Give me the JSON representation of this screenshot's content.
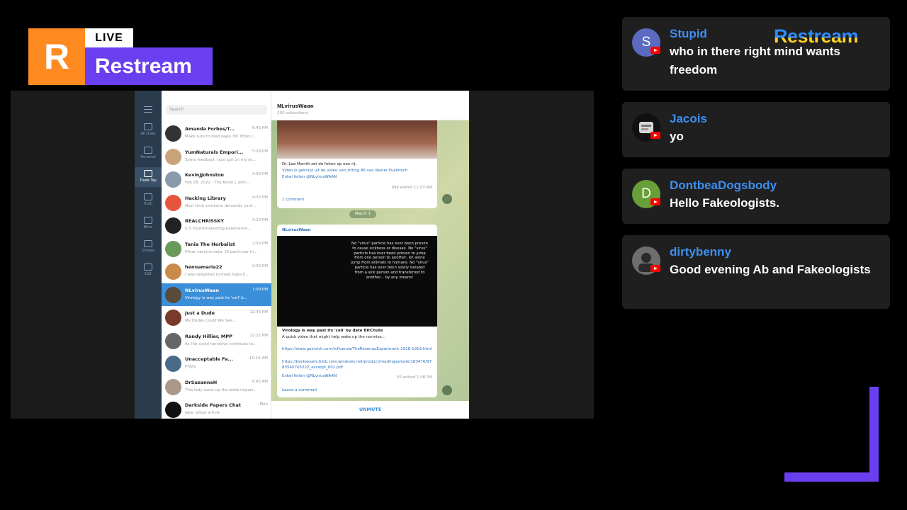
{
  "badge": {
    "logo_letter": "R",
    "live_label": "LIVE",
    "brand_name": "Restream"
  },
  "colors": {
    "brand_orange": "#ff8a1f",
    "brand_purple": "#6a3ff0",
    "author_blue": "#3d8ff0",
    "card_bg": "#1f1f1f"
  },
  "telegram": {
    "search_placeholder": "Search",
    "rail": [
      {
        "label": "All chats",
        "icon": "chat-bubble-icon"
      },
      {
        "label": "Personal",
        "icon": "folder-icon"
      },
      {
        "label": "Trade Top",
        "icon": "folder-icon"
      },
      {
        "label": "Truth",
        "icon": "folder-icon"
      },
      {
        "label": "Bitco",
        "icon": "folder-icon"
      },
      {
        "label": "Unread",
        "icon": "chat-bubble-icon"
      },
      {
        "label": "Edit",
        "icon": "sliders-icon"
      }
    ],
    "chats": [
      {
        "name": "Amanda Forbes/T...",
        "time": "6:45 PM",
        "preview": "Make sure to read page 30! https:/...",
        "color": "#333"
      },
      {
        "name": "YumNaturals Empori...",
        "time": "5:29 PM",
        "preview": "Some feedback i just got on my so...",
        "color": "#c9a47b"
      },
      {
        "name": "KevinJJohnston",
        "time": "3:00 PM",
        "preview": "Feb 28, 2022 - The Kevin J. John...",
        "color": "#8899aa"
      },
      {
        "name": "Hacking Library",
        "time": "4:55 PM",
        "preview": "Next time someone demands yout...",
        "color": "#e5553b"
      },
      {
        "name": "REALCHRISSKY",
        "time": "3:20 PM",
        "preview": "5.5.0-postmarketing-experience...",
        "color": "#222"
      },
      {
        "name": "Tania The Herbalist",
        "time": "2:50 PM",
        "preview": "Pfizer vaccine data. Of particular in...",
        "color": "#6a9a5a"
      },
      {
        "name": "hennamaria22",
        "time": "2:33 PM",
        "preview": "I was delighted to meet Kajia tl...",
        "color": "#c98a4a"
      },
      {
        "name": "NLvirusWaan",
        "time": "1:09 PM",
        "preview": "Virology is way past its 'cell' b...",
        "color": "#5a4a3a"
      },
      {
        "name": "Just a Dude",
        "time": "12:45 PM",
        "preview": "My Dudes Could We See...",
        "color": "#7a3a2a"
      },
      {
        "name": "Randy Hillier, MPP",
        "time": "12:21 PM",
        "preview": "As the covid narrative continues to...",
        "color": "#666"
      },
      {
        "name": "Unacceptable Fa...",
        "time": "10:19 AM",
        "preview": "Photo",
        "color": "#4a6a8a"
      },
      {
        "name": "DrSuzanneH",
        "time": "9:43 AM",
        "preview": "This lady sums up the woke import...",
        "color": "#aa9988"
      },
      {
        "name": "Darkside Papers Chat",
        "time": "Mon",
        "preview": "Jake: Great article",
        "color": "#111"
      }
    ],
    "channel_title": "NLvirusWaan",
    "channel_subtitle": "293 subscribers",
    "msg1": {
      "line1": "Dr. Lee Merritt zet de feiten op een rij:",
      "line2": "Video is geknipt uit de video van zitting 86 van Reiner Fuellmich",
      "line3": "Enkel feiten @NLvirusWAAN",
      "views": "994 edited 11:03 AM",
      "comments": "1 comment"
    },
    "date_label": "March 1",
    "msg2": {
      "sender": "NLvirusWaan",
      "video_text": "No \"virus\" particle has ever been proven to cause sickness or disease. No \"virus\" particle has ever been proven to jump from one person to another, let alone jump from animals to humans. No \"virus\" particle has ever been solely isolated from a sick person and transferred to another... by any means!",
      "caption1": "Virology is way past its 'cell' by date BitChute",
      "caption2": "A quick video that might help wake up the normies...",
      "link1": "https://www.gainvick.com/influenza/TheRosenauExperiment-1918-1919.html",
      "link2": "https://beckassets.blob.core.windows.net/product/readingsample/183476/9783540705222_excerpt_001.pdf",
      "footer": "Enkel feiten @NLvirusWAAN",
      "meta": "56 edited 1:08 PM",
      "leave_comment": "Leave a comment"
    },
    "unmute_label": "UNMUTE"
  },
  "chat_messages": [
    {
      "author": "Stupid",
      "text": "who in there right mind wants freedom",
      "avatar_letter": "S",
      "avatar_color": "#5c6bc0"
    },
    {
      "author": "Jacois",
      "text": "yo",
      "avatar_letter": "",
      "avatar_color": "#cfcfcf"
    },
    {
      "author": "DontbeaDogsbody",
      "text": "Hello Fakeologists.",
      "avatar_letter": "D",
      "avatar_color": "#689f38"
    },
    {
      "author": "dirtybenny",
      "text": "Good evening Ab and Fakeologists",
      "avatar_letter": "",
      "avatar_color": "#8a8a8a"
    }
  ],
  "watermark": "Restream"
}
